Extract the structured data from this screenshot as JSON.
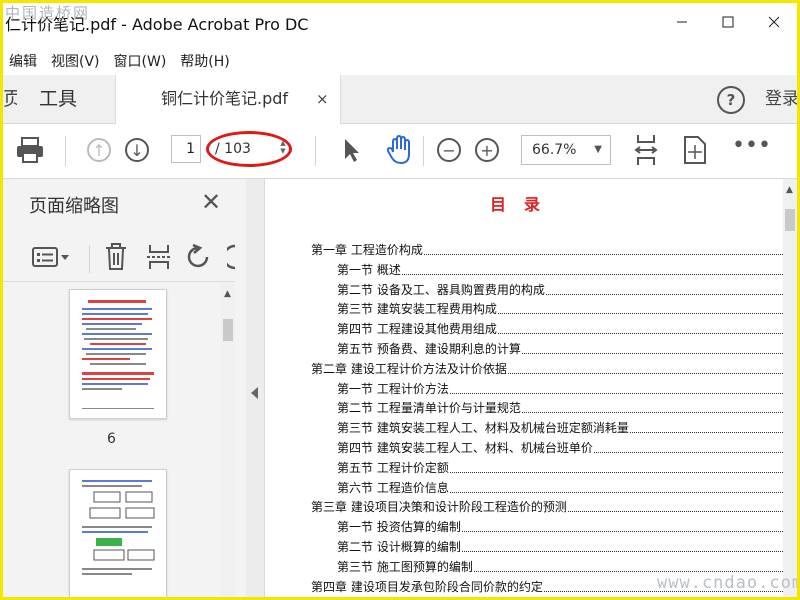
{
  "window": {
    "title": "仁计价笔记.pdf - Adobe Acrobat Pro DC",
    "watermark_top": "中国造桥网"
  },
  "menu": [
    "编辑",
    "视图(V)",
    "窗口(W)",
    "帮助(H)"
  ],
  "tabs": {
    "home_partial": "页",
    "tools": "工具",
    "document": "铜仁计价笔记.pdf",
    "close": "×",
    "help": "?",
    "signin": "登录"
  },
  "toolbar": {
    "current_page": "1",
    "page_total": "/ 103",
    "zoom": "66.7%"
  },
  "left_panel": {
    "title": "页面缩略图",
    "thumbnails": [
      {
        "page": "6"
      },
      {
        "page": ""
      }
    ]
  },
  "document": {
    "heading": "目录",
    "toc": [
      {
        "text": "第一章  工程造价构成",
        "level": 1
      },
      {
        "text": "第一节  概述",
        "level": 2
      },
      {
        "text": "第二节  设备及工、器具购置费用的构成",
        "level": 2
      },
      {
        "text": "第三节  建筑安装工程费用构成",
        "level": 2
      },
      {
        "text": "第四节  工程建设其他费用组成",
        "level": 2
      },
      {
        "text": "第五节  预备费、建设期利息的计算",
        "level": 2
      },
      {
        "text": "第二章  建设工程计价方法及计价依据",
        "level": 1
      },
      {
        "text": "第一节  工程计价方法",
        "level": 2
      },
      {
        "text": "第二节  工程量清单计价与计量规范",
        "level": 2
      },
      {
        "text": "第三节  建筑安装工程人工、材料及机械台班定额消耗量",
        "level": 2
      },
      {
        "text": "第四节  建筑安装工程人工、材料、机械台班单价",
        "level": 2
      },
      {
        "text": "第五节  工程计价定额",
        "level": 2
      },
      {
        "text": "第六节  工程造价信息",
        "level": 2
      },
      {
        "text": "第三章  建设项目决策和设计阶段工程造价的预测",
        "level": 1
      },
      {
        "text": "第一节  投资估算的编制",
        "level": 2
      },
      {
        "text": "第二节  设计概算的编制",
        "level": 2
      },
      {
        "text": "第三节  施工图预算的编制",
        "level": 2
      },
      {
        "text": "第四章  建设项目发承包阶段合同价款的约定",
        "level": 1
      }
    ],
    "watermark_bottom": "www.cndao.com"
  },
  "colors": {
    "border_highlight": "#f3e600",
    "annotation_red": "#e01818",
    "heading_red": "#e02020",
    "hand_tool_blue": "#2a6ad6"
  }
}
